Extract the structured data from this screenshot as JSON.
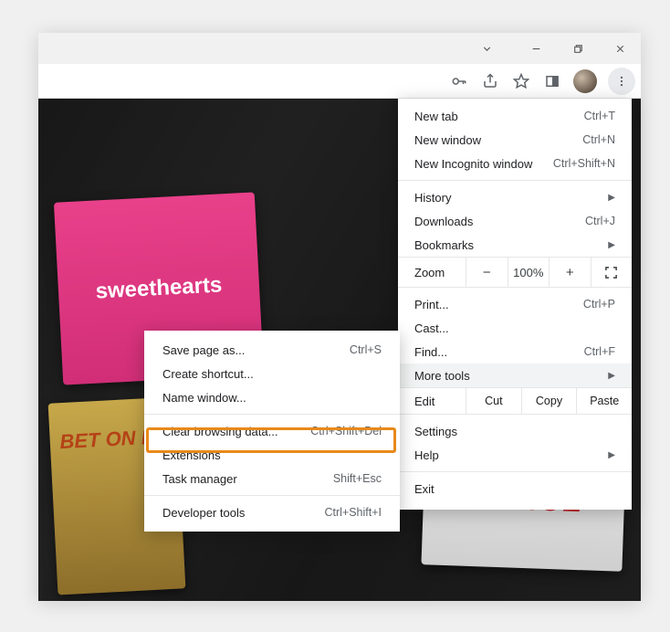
{
  "posters": {
    "sweethearts": "sweethearts",
    "bet": "BET ON FR",
    "furioz": "FURIOZ"
  },
  "menu": {
    "newTab": {
      "label": "New tab",
      "shortcut": "Ctrl+T"
    },
    "newWindow": {
      "label": "New window",
      "shortcut": "Ctrl+N"
    },
    "newIncognito": {
      "label": "New Incognito window",
      "shortcut": "Ctrl+Shift+N"
    },
    "history": {
      "label": "History"
    },
    "downloads": {
      "label": "Downloads",
      "shortcut": "Ctrl+J"
    },
    "bookmarks": {
      "label": "Bookmarks"
    },
    "zoom": {
      "label": "Zoom",
      "minus": "−",
      "pct": "100%",
      "plus": "+"
    },
    "print": {
      "label": "Print...",
      "shortcut": "Ctrl+P"
    },
    "cast": {
      "label": "Cast..."
    },
    "find": {
      "label": "Find...",
      "shortcut": "Ctrl+F"
    },
    "moreTools": {
      "label": "More tools"
    },
    "edit": {
      "label": "Edit",
      "cut": "Cut",
      "copy": "Copy",
      "paste": "Paste"
    },
    "settings": {
      "label": "Settings"
    },
    "help": {
      "label": "Help"
    },
    "exit": {
      "label": "Exit"
    }
  },
  "submenu": {
    "savePage": {
      "label": "Save page as...",
      "shortcut": "Ctrl+S"
    },
    "createShortcut": {
      "label": "Create shortcut..."
    },
    "nameWindow": {
      "label": "Name window..."
    },
    "clearBrowsing": {
      "label": "Clear browsing data...",
      "shortcut": "Ctrl+Shift+Del"
    },
    "extensions": {
      "label": "Extensions"
    },
    "taskManager": {
      "label": "Task manager",
      "shortcut": "Shift+Esc"
    },
    "devTools": {
      "label": "Developer tools",
      "shortcut": "Ctrl+Shift+I"
    }
  }
}
